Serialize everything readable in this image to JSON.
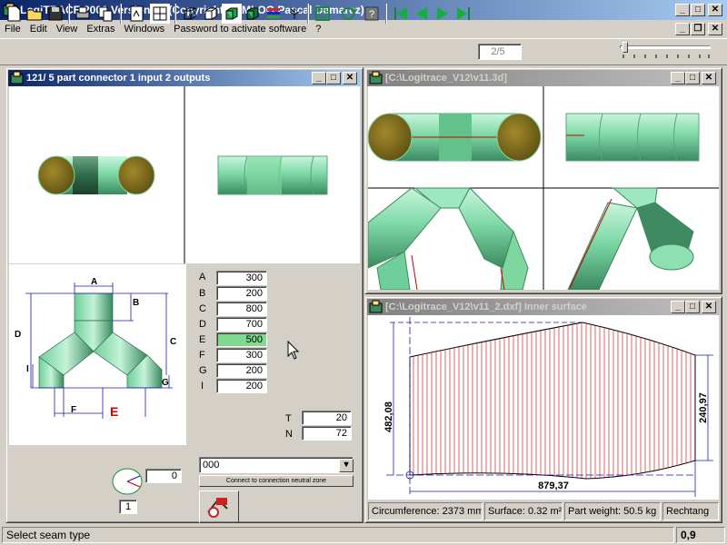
{
  "app": {
    "title": "LogiTRACE 2000  Version 12  (Copyright DEMLOG Pascal Demarez)"
  },
  "menu": [
    "File",
    "Edit",
    "View",
    "Extras",
    "Windows",
    "Password to activate software",
    "?"
  ],
  "toolbar": {
    "page": "2/5"
  },
  "window_main": {
    "title": "121/ 5 part connector 1 input 2 outputs",
    "params": [
      {
        "label": "A",
        "value": "300"
      },
      {
        "label": "B",
        "value": "200"
      },
      {
        "label": "C",
        "value": "800"
      },
      {
        "label": "D",
        "value": "700"
      },
      {
        "label": "E",
        "value": "500"
      },
      {
        "label": "F",
        "value": "300"
      },
      {
        "label": "G",
        "value": "200"
      },
      {
        "label": "I",
        "value": "200"
      }
    ],
    "diagram_labels": {
      "A": "A",
      "B": "B",
      "C": "C",
      "D": "D",
      "I": "I",
      "F": "F",
      "E": "E",
      "G": "G"
    },
    "t_label": "T",
    "t_value": "20",
    "n_label": "N",
    "n_value": "72",
    "angle_value": "0",
    "small_value": "1",
    "combo_value": "000",
    "button_label": "Connect to connection neutral zone"
  },
  "window_3d": {
    "title": "[C:\\Logitrace_V12\\v11.3d]"
  },
  "window_dxf": {
    "title": "[C:\\Logitrace_V12\\v11_2.dxf]  Inner surface",
    "dim_left": "482,08",
    "dim_right": "240,97",
    "dim_bottom": "879,37",
    "info": [
      "Circumference: 2373 mm",
      "Surface: 0.32 m²",
      "Part weight: 50.5 kg",
      "Rechtang"
    ]
  },
  "status": {
    "text": "Select seam type",
    "value": "0,9"
  },
  "colors": {
    "pipe": "#8fe0b0",
    "pipe_dark": "#2f6b4a",
    "accent_red": "#cc0000",
    "highlight": "#7fd98f"
  }
}
